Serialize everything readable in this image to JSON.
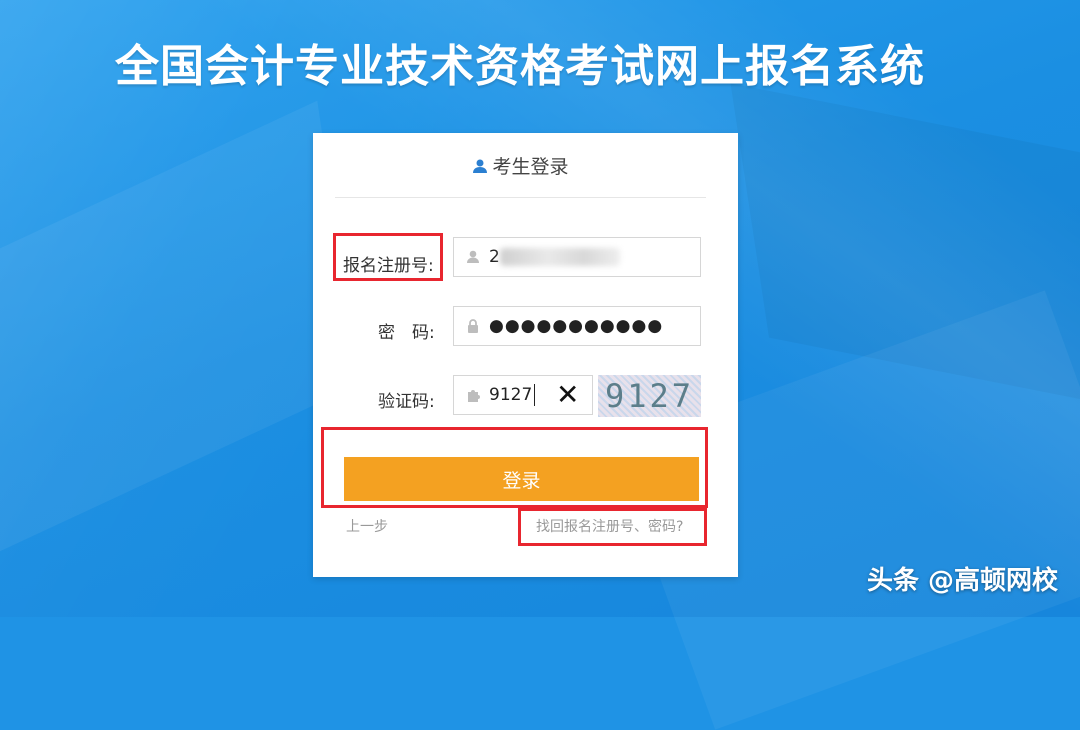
{
  "app": {
    "title": "全国会计专业技术资格考试网上报名系统"
  },
  "login_card": {
    "header": "考生登录",
    "fields": {
      "registration_label": "报名注册号:",
      "registration_value_prefix": "2",
      "password_label": "密　码:",
      "password_value": "●●●●●●●●●●●",
      "captcha_label": "验证码:",
      "captcha_value": "9127",
      "captcha_image_text": "9127"
    },
    "login_button": "登录",
    "prev_link": "上一步",
    "recover_link": "找回报名注册号、密码?"
  },
  "watermark": "头条 @高顿网校",
  "colors": {
    "background": "#1f93e5",
    "button": "#f4a121",
    "highlight": "#e8262f"
  },
  "icons": [
    "user-icon",
    "person-icon",
    "lock-icon",
    "puzzle-icon",
    "clear-icon"
  ]
}
